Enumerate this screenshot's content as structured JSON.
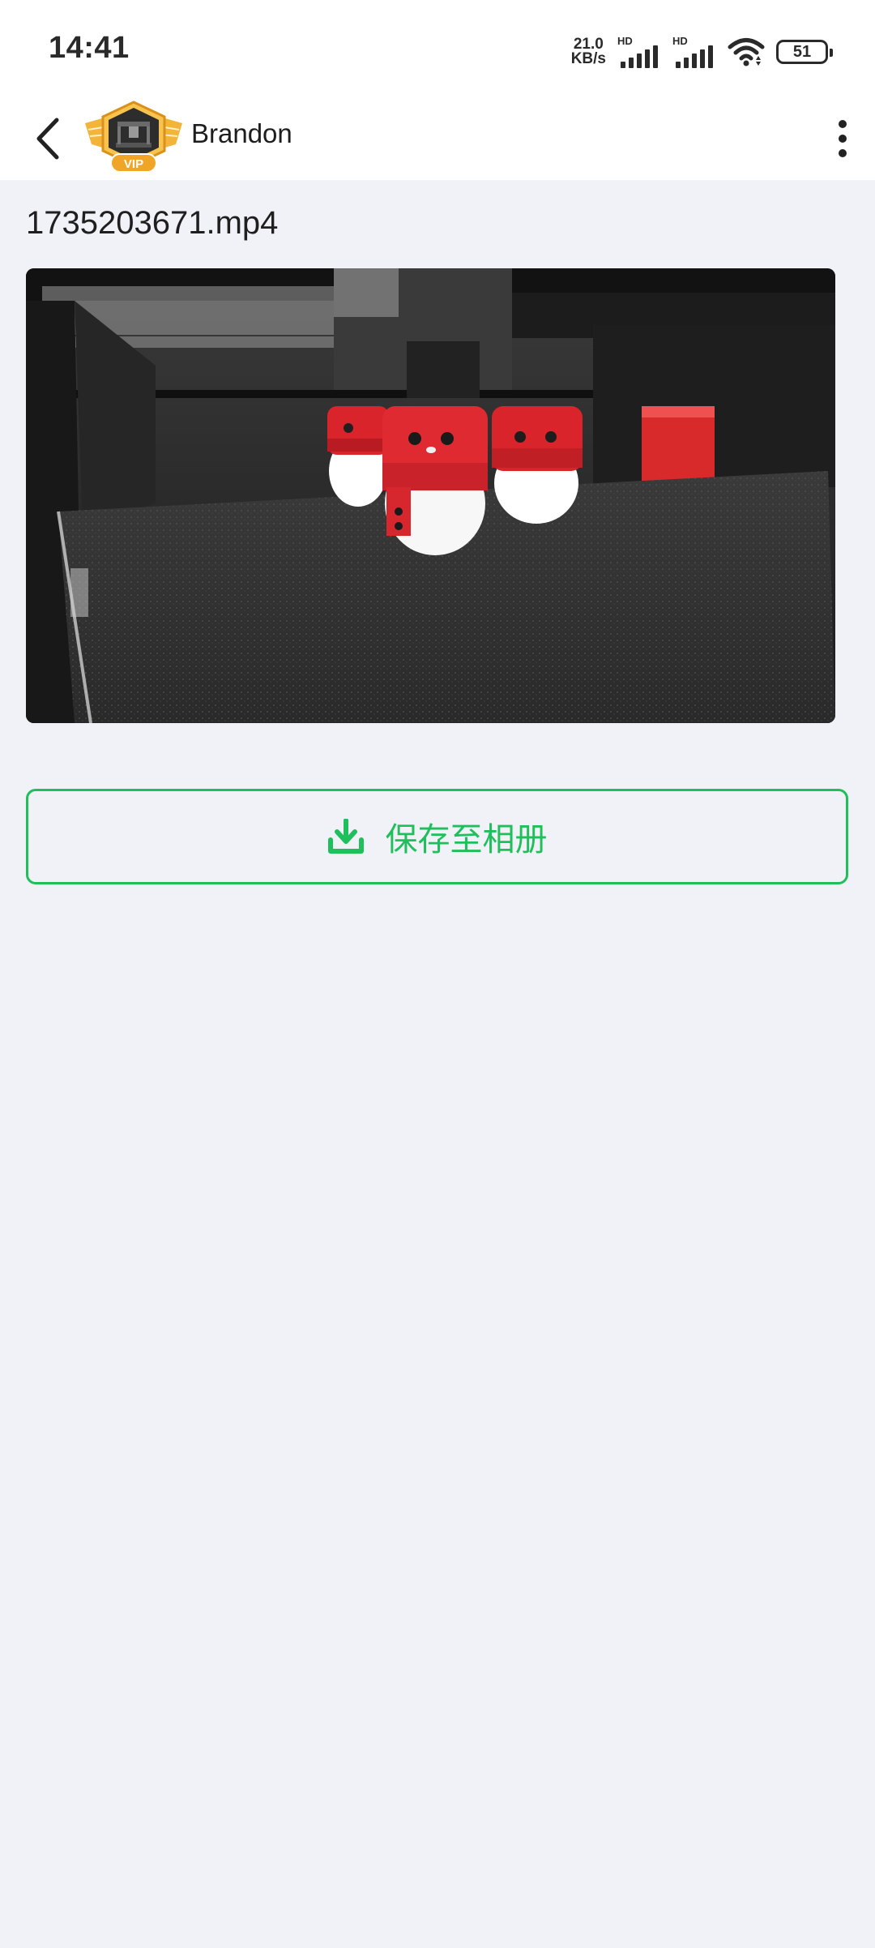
{
  "status_bar": {
    "time": "14:41",
    "net_speed_value": "21.0",
    "net_speed_unit": "KB/s",
    "signal_1_label": "HD",
    "signal_2_label": "HD",
    "battery_level": "51"
  },
  "header": {
    "user_name": "Brandon",
    "avatar_badge": "VIP"
  },
  "content": {
    "file_name": "1735203671.mp4",
    "save_button_label": "保存至相册"
  },
  "colors": {
    "accent": "#1fbf5b",
    "background": "#f0f2f7",
    "avatar_gold": "#f3b43a"
  }
}
